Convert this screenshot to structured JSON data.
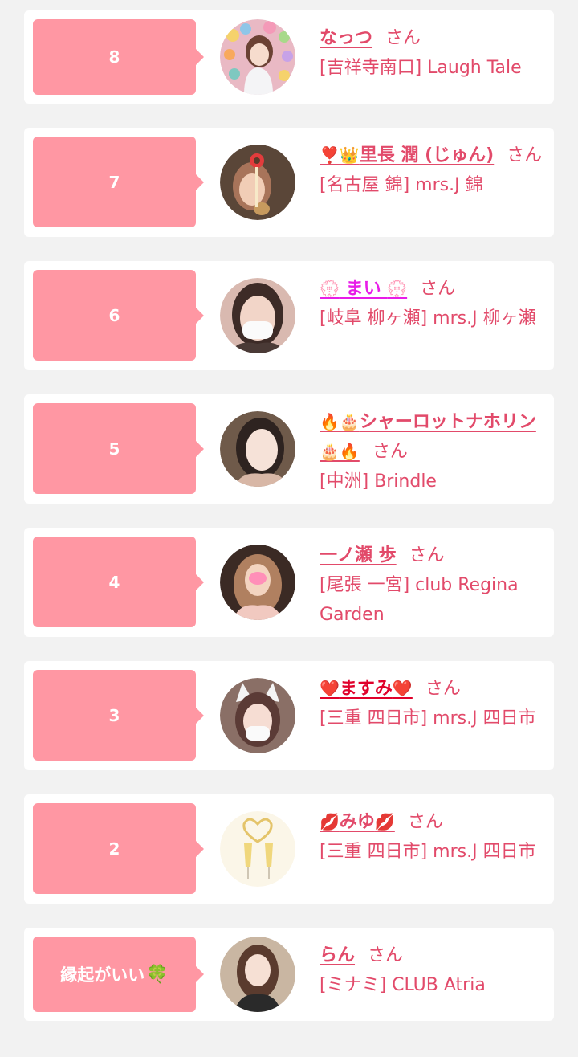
{
  "entries": [
    {
      "rank": "8",
      "name": "なっつ",
      "honorific": "さん",
      "shop": "[吉祥寺南口] Laugh Tale",
      "avatar": "woman-portrait"
    },
    {
      "rank": "7",
      "name_prefix_icons": "❣️👑",
      "name": "里長 潤 (じゅん)",
      "honorific": "さん",
      "shop": "[名古屋 錦] mrs.J 錦",
      "avatar": "woman-portrait"
    },
    {
      "rank": "6",
      "name_prefix_icons": "💮",
      "name": " まい ",
      "name_suffix_icons": "💮",
      "honorific": "さん",
      "shop": "[岐阜 柳ヶ瀬] mrs.J 柳ヶ瀬",
      "avatar": "woman-portrait"
    },
    {
      "rank": "5",
      "name_prefix_icons": "🔥🎂",
      "name": "シャーロットナホリン",
      "name_suffix_icons": "🎂🔥",
      "honorific": "さん",
      "shop": "[中洲] Brindle",
      "avatar": "woman-portrait"
    },
    {
      "rank": "4",
      "name": "一ノ瀬 歩",
      "honorific": "さん",
      "shop": "[尾張 一宮] club Regina Garden",
      "avatar": "woman-portrait"
    },
    {
      "rank": "3",
      "name_prefix_icons": "❤️",
      "name": "ますみ",
      "name_suffix_icons": "❤️",
      "honorific": "さん",
      "shop": "[三重 四日市] mrs.J 四日市",
      "avatar": "woman-portrait"
    },
    {
      "rank": "2",
      "name_prefix_icons": "💋",
      "name": "みゆ",
      "name_suffix_icons": "💋",
      "honorific": "さん",
      "shop": "[三重 四日市] mrs.J 四日市",
      "avatar": "champagne-glasses"
    },
    {
      "rank": "縁起がいい",
      "rank_icon": "🍀",
      "name": "らん",
      "honorific": "さん",
      "shop": "[ミナミ] CLUB Atria",
      "avatar": "woman-portrait"
    }
  ],
  "colors": {
    "background": "#f2f2f2",
    "card": "#ffffff",
    "rank_badge": "#ff97a3",
    "accent_text": "#e24a6a"
  }
}
